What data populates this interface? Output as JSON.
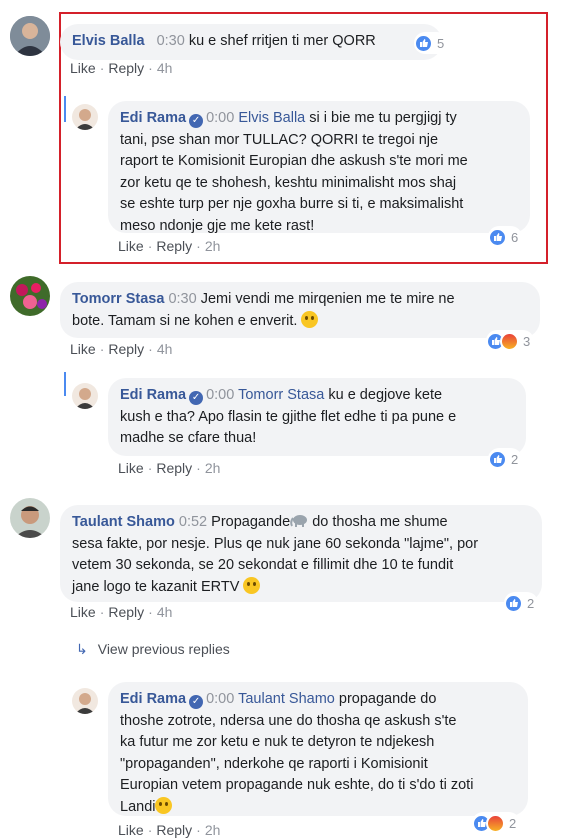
{
  "actions": {
    "like": "Like",
    "reply": "Reply"
  },
  "view_previous": "View previous replies",
  "comments": [
    {
      "author": "Elvis Balla",
      "ts": "0:30",
      "text": "ku e shef rritjen ti mer QORR",
      "time": "4h",
      "reactions": "5"
    },
    {
      "author": "Edi Rama",
      "ts": "0:00",
      "mention": "Elvis Balla",
      "lines": [
        "si i bie me tu pergjigj ty",
        "tani, pse shan mor TULLAC? QORRI te tregoi nje",
        "raport te Komisionit Europian dhe askush s'te mori me",
        "zor ketu qe te shohesh, keshtu minimalisht mos shaj",
        "se eshte turp per nje goxha burre si ti, e maksimalisht",
        "meso ndonje gje me kete rast!"
      ],
      "time": "2h",
      "reactions": "6"
    },
    {
      "author": "Tomorr Stasa",
      "ts": "0:30",
      "lines": [
        "Jemi vendi me mirqenien me te mire ne",
        "bote. Tamam si ne kohen e enverit."
      ],
      "time": "4h",
      "reactions": "3"
    },
    {
      "author": "Edi Rama",
      "ts": "0:00",
      "mention": "Tomorr Stasa",
      "lines": [
        "ku e degjove kete",
        "kush e tha? Apo flasin te gjithe flet edhe ti pa pune e",
        "madhe se cfare thua!"
      ],
      "time": "2h",
      "reactions": "2"
    },
    {
      "author": "Taulant Shamo",
      "ts": "0:52",
      "lines": [
        "Propagande",
        "do thosha me shume",
        "sesa fakte, por nesje. Plus qe nuk jane 60 sekonda \"lajme\", por",
        "vetem 30 sekonda, se 20 sekondat e fillimit dhe 10 te fundit",
        "jane logo te kazanit ERTV"
      ],
      "time": "4h",
      "reactions": "2"
    },
    {
      "author": "Edi Rama",
      "ts": "0:00",
      "mention": "Taulant Shamo",
      "lines": [
        "propagande do",
        "thoshe zotrote, ndersa une do thosha qe askush s'te",
        "ka futur me zor ketu e nuk te detyron te ndjekesh",
        "\"propaganden\", nderkohe qe raporti i Komisionit",
        "Europian vetem propagande nuk eshte, do ti s'do ti zoti",
        "Landi"
      ],
      "time": "2h",
      "reactions": "2"
    }
  ]
}
